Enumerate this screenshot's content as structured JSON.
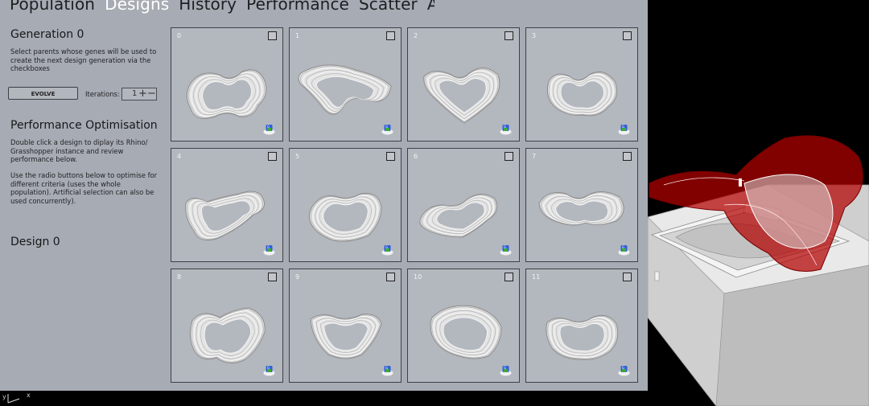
{
  "tabs": [
    {
      "label": "Population"
    },
    {
      "label": "Designs",
      "active": true
    },
    {
      "label": "History"
    },
    {
      "label": "Performance"
    },
    {
      "label": "Scatter"
    },
    {
      "label": "About"
    }
  ],
  "sidebar": {
    "generation_title": "Generation 0",
    "generation_help": "Select parents whose genes will be used to create the next design generation via the checkboxes",
    "evolve_label": "EVOLVE",
    "iterations_label": "Iterations:",
    "iterations_value": "1",
    "optimisation_title": "Performance Optimisation",
    "optimisation_help_1": "Double click a design to diplay its Rhino/ Grasshopper instance and review performance below.",
    "optimisation_help_2": "Use the radio buttons below to optimise for different criteria (uses the whole population). Artificial selection can also be used concurrently).",
    "design_title": "Design 0"
  },
  "designs": [
    "0",
    "1",
    "2",
    "3",
    "4",
    "5",
    "6",
    "7",
    "8",
    "9",
    "10",
    "11"
  ],
  "viewport": {
    "axis_y": "y",
    "axis_x": "x",
    "highlight_color": "#b30000"
  },
  "colors": {
    "panel": "#a7abb3",
    "active_tab": "#ffffff",
    "card": "#b3b7be"
  }
}
